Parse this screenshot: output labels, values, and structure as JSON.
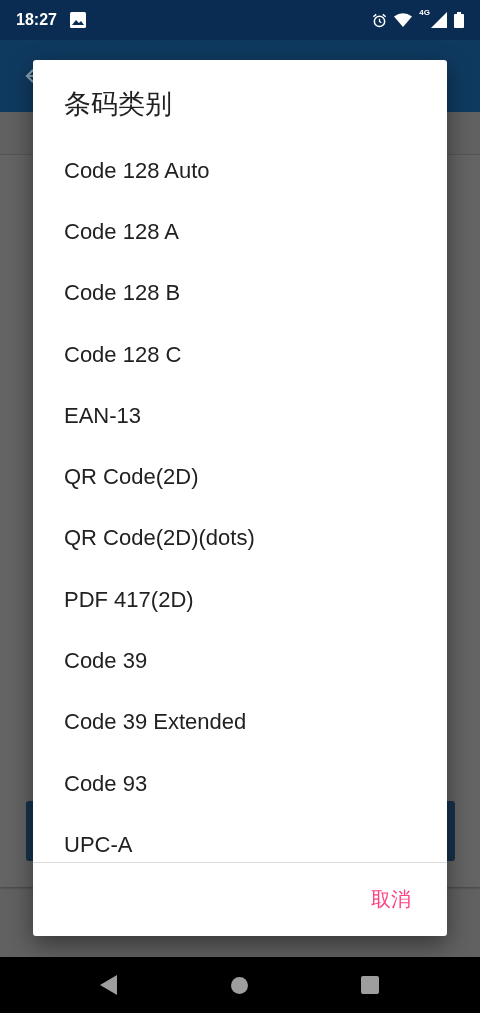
{
  "status_bar": {
    "time": "18:27",
    "network": "4G"
  },
  "dialog": {
    "title": "条码类别",
    "items": [
      {
        "label": "Code 128 Auto"
      },
      {
        "label": "Code 128 A"
      },
      {
        "label": "Code 128 B"
      },
      {
        "label": "Code 128 C"
      },
      {
        "label": "EAN-13"
      },
      {
        "label": "QR Code(2D)"
      },
      {
        "label": "QR Code(2D)(dots)"
      },
      {
        "label": "PDF 417(2D)"
      },
      {
        "label": "Code 39"
      },
      {
        "label": "Code 39 Extended"
      },
      {
        "label": "Code 93"
      },
      {
        "label": "UPC-A"
      }
    ],
    "buttons": [
      "取消"
    ]
  }
}
